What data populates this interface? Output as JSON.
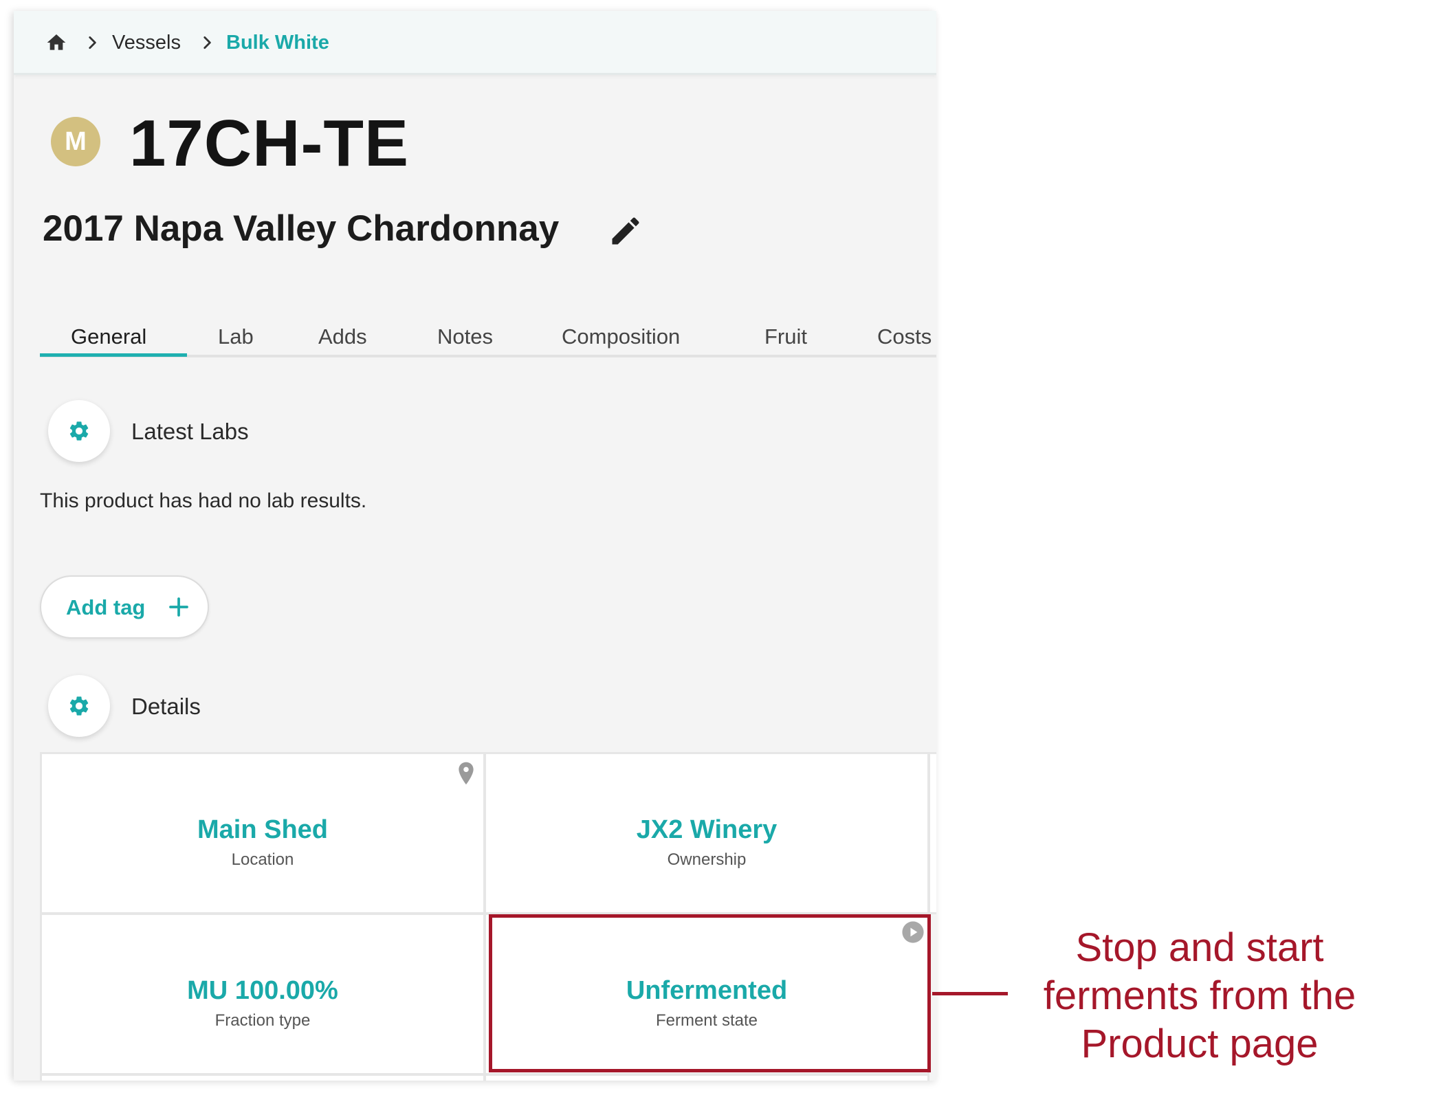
{
  "breadcrumb": {
    "home_icon": "home-icon",
    "items": [
      "Vessels",
      "Bulk White"
    ],
    "separator_icon": "chevron-right-icon"
  },
  "vessel": {
    "avatar_letter": "M",
    "code": "17CH-TE",
    "product_name": "2017 Napa Valley Chardonnay",
    "edit_icon": "pencil-icon"
  },
  "tabs": [
    {
      "label": "General",
      "active": true
    },
    {
      "label": "Lab"
    },
    {
      "label": "Adds"
    },
    {
      "label": "Notes"
    },
    {
      "label": "Composition"
    },
    {
      "label": "Fruit"
    },
    {
      "label": "Costs"
    }
  ],
  "latest_labs": {
    "title": "Latest Labs",
    "empty_message": "This product has had no lab results.",
    "settings_icon": "gear-icon"
  },
  "add_tag": {
    "label": "Add tag",
    "icon": "plus-icon"
  },
  "details": {
    "title": "Details",
    "settings_icon": "gear-icon",
    "cards": [
      {
        "value": "Main Shed",
        "label": "Location",
        "icon": "map-pin-icon"
      },
      {
        "value": "JX2 Winery",
        "label": "Ownership"
      },
      {
        "value": "MU 100.00%",
        "label": "Fraction type"
      },
      {
        "value": "Unfermented",
        "label": "Ferment state",
        "icon": "play-circle-icon"
      }
    ]
  },
  "annotation": {
    "text": "Stop and start\nferments from the\nProduct page",
    "color": "#a5172a"
  },
  "colors": {
    "accent": "#1aa9a9",
    "avatar": "#d3c080",
    "annotation": "#a5172a"
  }
}
